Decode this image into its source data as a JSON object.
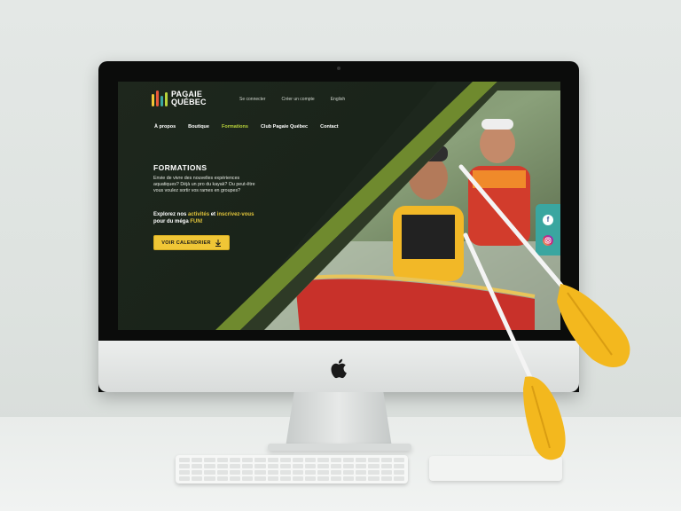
{
  "site": {
    "logo_line1": "PAGAIE",
    "logo_line2": "QUÉBEC"
  },
  "top_links": [
    "Se connecter",
    "Créer un compte",
    "English"
  ],
  "nav": {
    "items": [
      "À propos",
      "Boutique",
      "Formations",
      "Club Pagaie Québec",
      "Contact"
    ],
    "active": "Formations"
  },
  "hero": {
    "title": "FORMATIONS",
    "text": "Envie de vivre des nouvelles expériences aquatiques? Déjà un pro du kayak? Ou peut-être vous voulez sortir vos rames en groupes?",
    "cta_prefix": "Explorez nos",
    "cta_link1": "activités",
    "cta_mid": "et",
    "cta_link2": "inscrivez-vous",
    "cta_suffix": "pour du méga",
    "cta_fun": "FUN!",
    "button_label": "VOIR CALENDRIER"
  },
  "social": {
    "facebook_icon": "facebook-icon",
    "instagram_icon": "instagram-icon"
  },
  "colors": {
    "background": "#1b231b",
    "accent_green": "#b8d23a",
    "accent_yellow": "#f0c636",
    "social_teal": "#3aa6a0"
  }
}
